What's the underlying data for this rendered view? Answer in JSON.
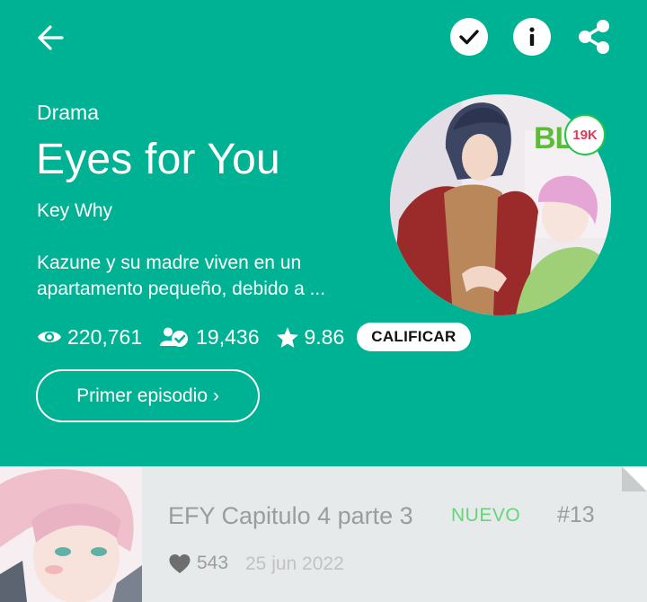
{
  "header": {
    "back_icon": "arrow-left-icon",
    "subscribe_icon": "check-icon",
    "info_icon": "info-icon",
    "share_icon": "share-icon"
  },
  "series": {
    "genre": "Drama",
    "title": "Eyes for You",
    "author": "Key Why",
    "synopsis_line1": "Kazune y su madre viven en un",
    "synopsis_line2": "apartamento pequeño, debido a ...",
    "cover_badge": "BL",
    "cover_count": "19K"
  },
  "stats": {
    "views": "220,761",
    "subscribers": "19,436",
    "rating": "9.86",
    "rate_label": "CALIFICAR"
  },
  "actions": {
    "first_episode_label": "Primer episodio ›"
  },
  "episode": {
    "title": "EFY Capitulo 4 parte 3",
    "badge": "NUEVO",
    "number": "#13",
    "likes": "543",
    "date": "25 jun 2022"
  },
  "colors": {
    "hero_bg": "#00b294",
    "episode_bg": "#e7eaea",
    "new_badge": "#67d47c"
  }
}
